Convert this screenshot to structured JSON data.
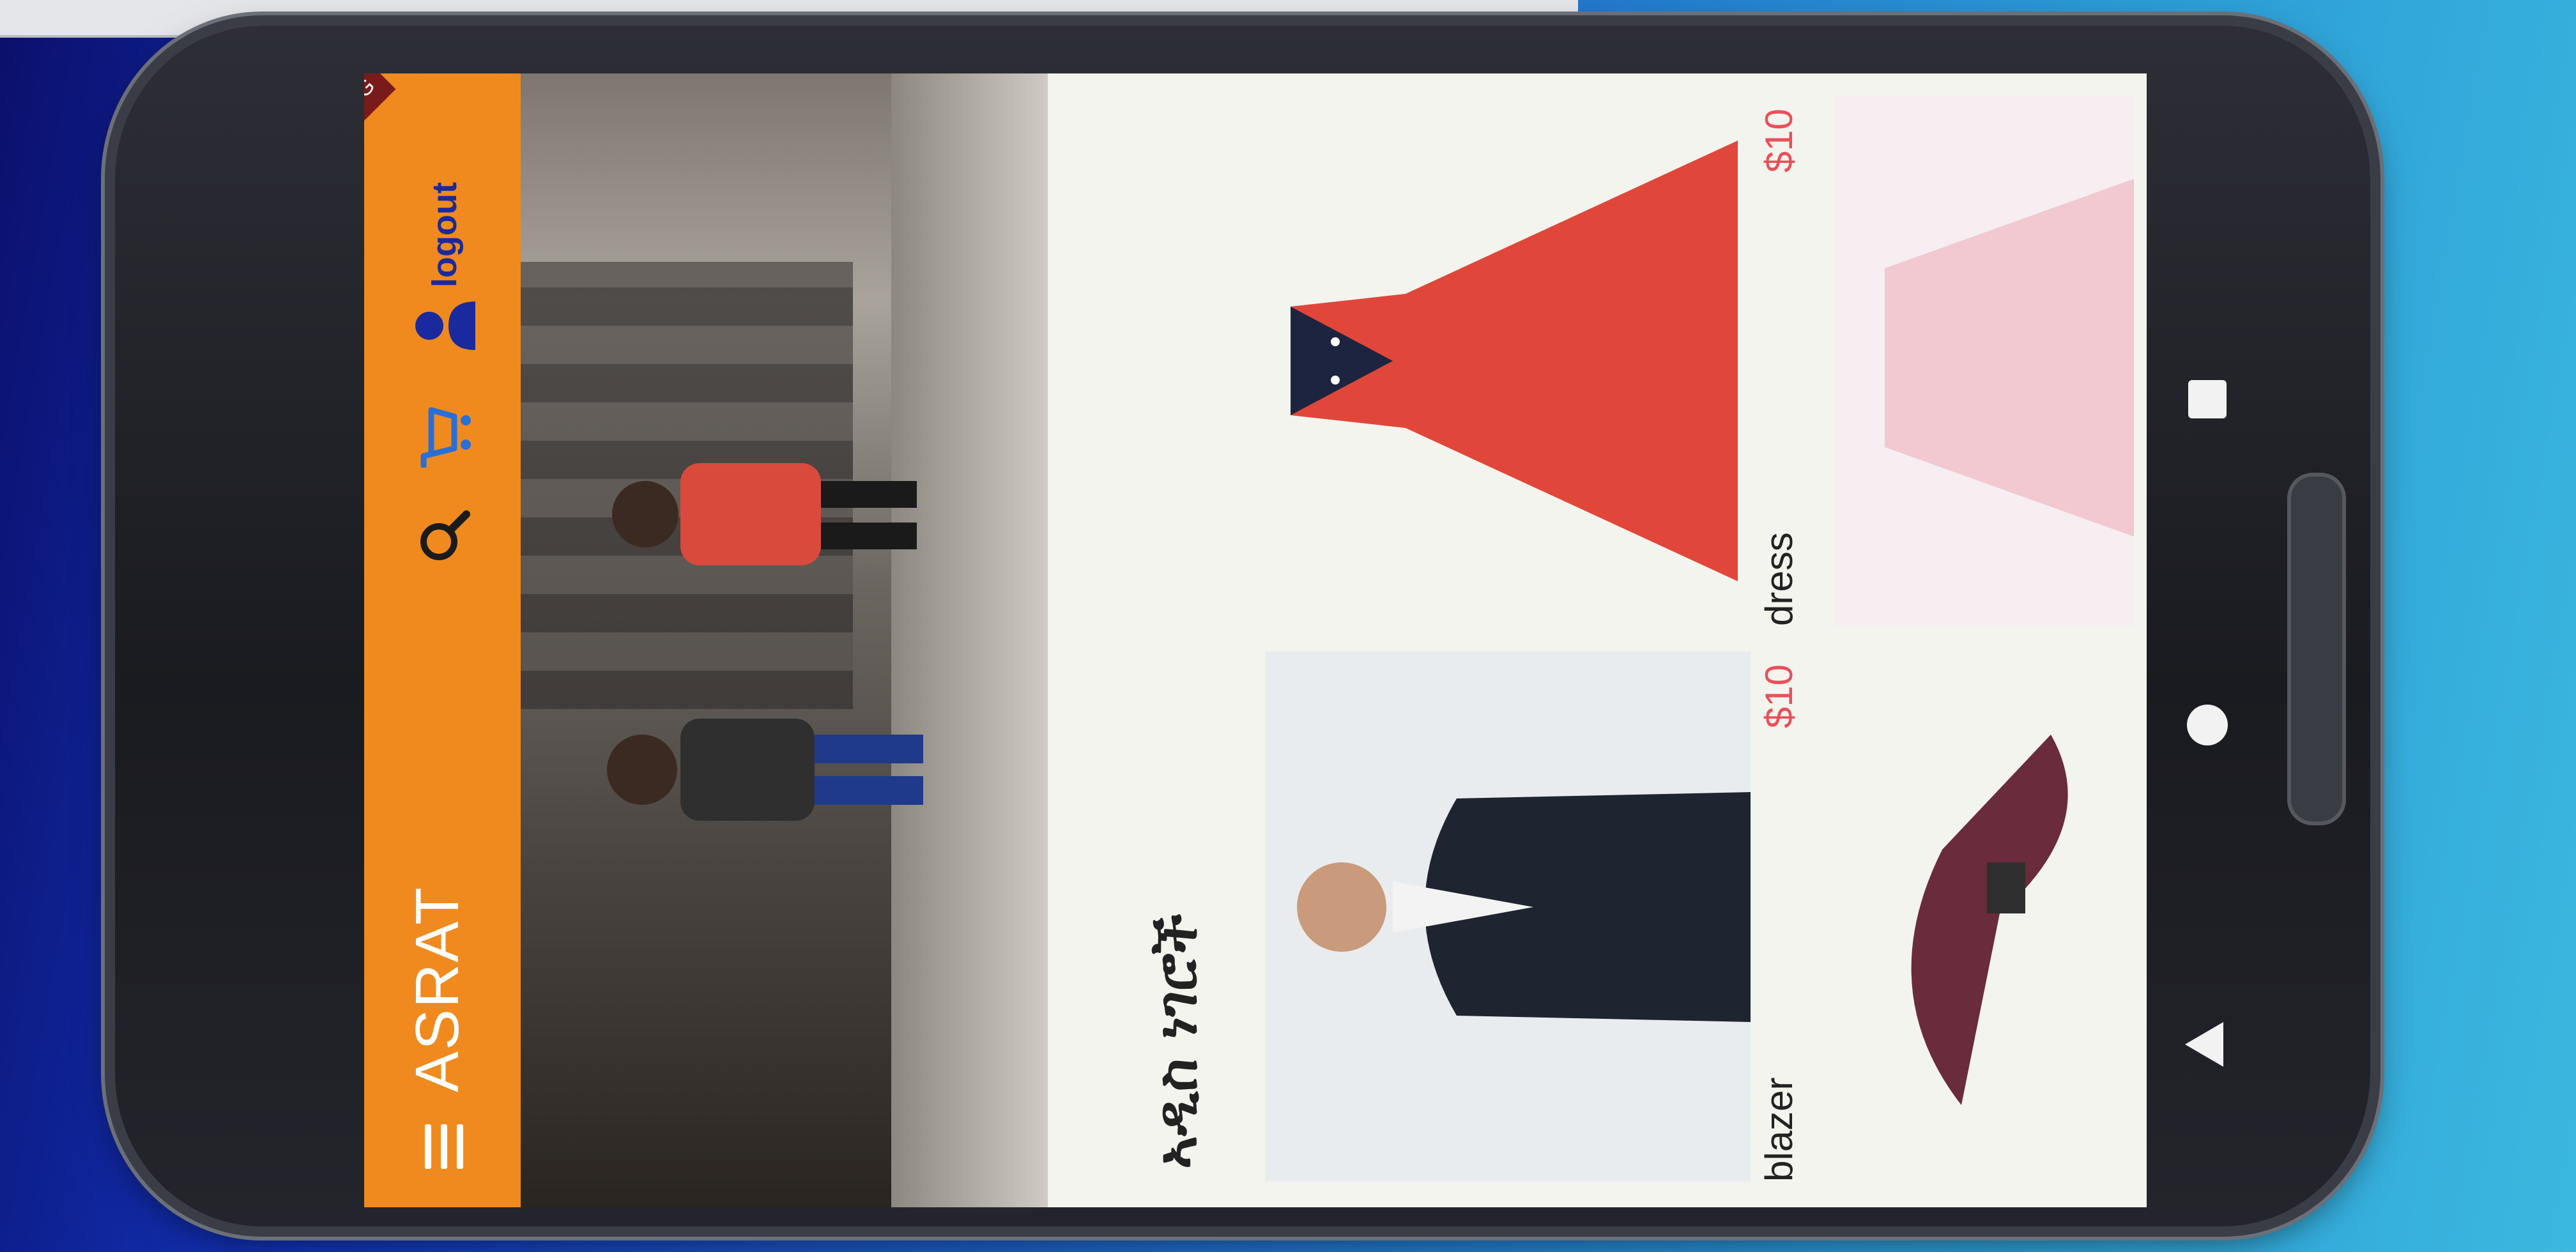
{
  "app": {
    "title": "ASRAT",
    "logout_label": "logout",
    "debug_label": "DEBUG"
  },
  "content": {
    "section_title": "ኣዲስ ነገሮች",
    "products": [
      {
        "name": "blazer",
        "price": "$10"
      },
      {
        "name": "dress",
        "price": "$10"
      }
    ]
  },
  "icons": {
    "menu": "menu-icon",
    "search": "search-icon",
    "cart": "cart-icon",
    "user": "user-icon",
    "back": "back-triangle-icon",
    "home": "home-circle-icon",
    "recents": "recents-square-icon"
  },
  "colors": {
    "appbar": "#f08a1e",
    "price": "#e9505a",
    "logout": "#1a2a9e"
  }
}
